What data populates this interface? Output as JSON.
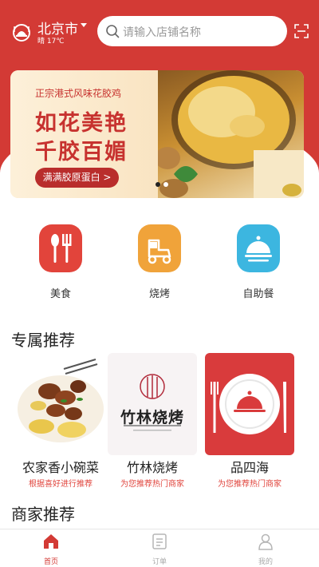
{
  "header": {
    "city": "北京市",
    "weather": "晴 17℃",
    "search_placeholder": "请输入店铺名称"
  },
  "banner": {
    "subtitle": "正宗港式风味花胶鸡",
    "headline_line1": "如花美艳",
    "headline_line2": "千胶百媚",
    "cta": "满满胶原蛋白 >"
  },
  "categories": [
    {
      "label": "美食",
      "icon": "fork-knife-icon",
      "color": "#e2443b"
    },
    {
      "label": "烧烤",
      "icon": "scooter-icon",
      "color": "#f0a33a"
    },
    {
      "label": "自助餐",
      "icon": "cloche-icon",
      "color": "#3cb6e0"
    }
  ],
  "sections": {
    "exclusive": "专属推荐",
    "merchants": "商家推荐"
  },
  "recommendations": [
    {
      "name": "农家香小碗菜",
      "sub": "根据喜好进行推荐"
    },
    {
      "name": "竹林烧烤",
      "sub": "为您推荐热门商家",
      "logo_text": "竹林烧烤"
    },
    {
      "name": "品四海",
      "sub": "为您推荐热门商家"
    }
  ],
  "tabbar": [
    {
      "label": "首页",
      "icon": "home-icon",
      "active": true
    },
    {
      "label": "订单",
      "icon": "order-icon",
      "active": false
    },
    {
      "label": "我的",
      "icon": "profile-icon",
      "active": false
    }
  ],
  "colors": {
    "brand_red": "#d33a35",
    "accent_red": "#e0443c"
  }
}
